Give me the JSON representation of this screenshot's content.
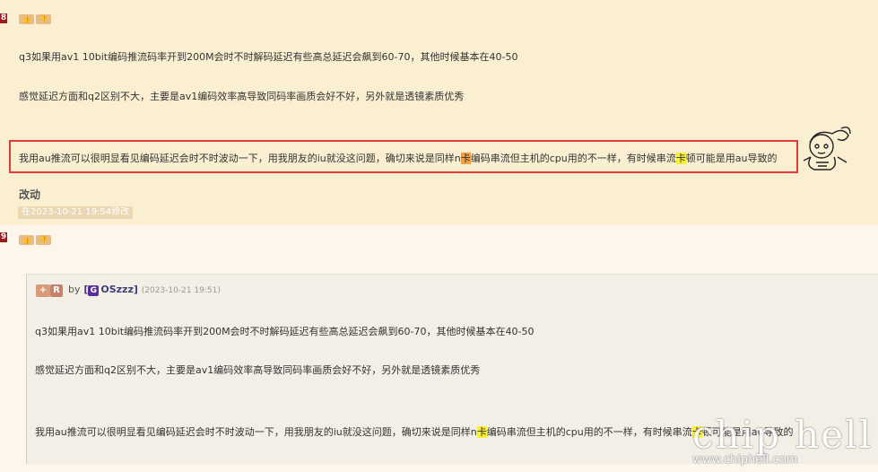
{
  "post1": {
    "floor": "8",
    "vote_up": "👍",
    "vote_down": "👎",
    "line1": "q3如果用av1 10bit编码推流码率开到200M会时不时解码延迟有些高总延迟会飙到60-70，其他时候基本在40-50",
    "line2": "感觉延迟方面和q2区别不大，主要是av1编码效率高导致同码率画质会好不好，另外就是透镜素质优秀",
    "line3_a": "我用au推流可以很明显看见编码延迟会时不时波动一下，用我朋友的iu就没这问题，确切来说是同样n",
    "line3_hl1": "卡",
    "line3_b": "编码串流但主机的cpu用的不一样，有时候串流",
    "line3_hl2": "卡",
    "line3_c": "顿可能是用au导致的",
    "edit_label": "改动",
    "edit_badge": "在2023-10-21 19:54修改"
  },
  "post2": {
    "floor": "9",
    "vote_up": "👍",
    "vote_down": "👎",
    "quote": {
      "rate_plus": "+",
      "rate_r": "R",
      "by": "by",
      "bracket_open": "[",
      "user_g": "G",
      "username": "OSzzz",
      "bracket_close": "]",
      "timestamp": "(2023-10-21 19:51)",
      "line1": "q3如果用av1 10bit编码推流码率开到200M会时不时解码延迟有些高总延迟会飙到60-70，其他时候基本在40-50",
      "line2": "感觉延迟方面和q2区别不大，主要是av1编码效率高导致同码率画质会好不好，另外就是透镜素质优秀",
      "line3_a": "我用au推流可以很明显看见编码延迟会时不时波动一下，用我朋友的iu就没这问题，确切来说是同样n",
      "line3_hl1": "卡",
      "line3_b": "编码串流但主机的cpu用的不一样，有时候串流",
      "line3_hl2": "卡",
      "line3_c": "顿可能是用au导致的"
    }
  },
  "watermark": {
    "logo": "chip hell",
    "url": "www.chiphell.com"
  },
  "colors": {
    "highlight_orange": "#f2a144",
    "highlight_yellow": "#f6f03a",
    "red_box": "#e53b3b",
    "floor_badge": "#9b1c1c"
  }
}
